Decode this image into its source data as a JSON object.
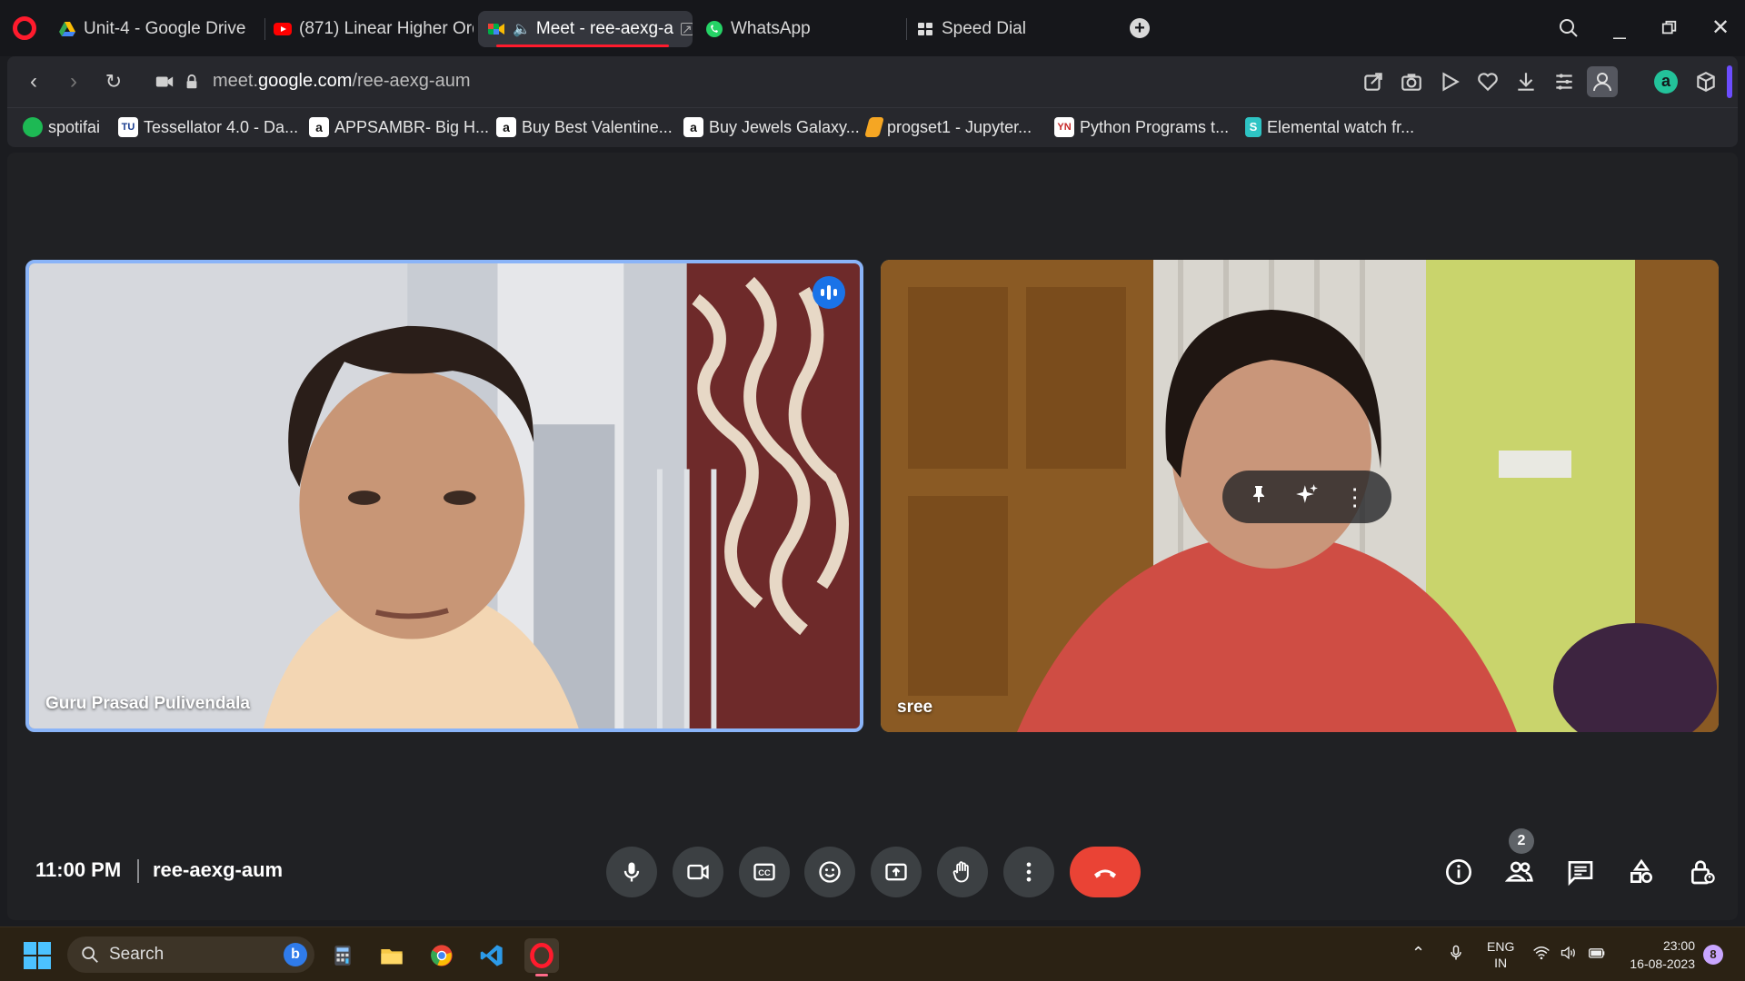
{
  "browser": {
    "tabs": [
      {
        "label": "Unit-4 - Google Drive",
        "icon": "google-drive-icon"
      },
      {
        "label": "(871) Linear Higher Ord",
        "icon": "youtube-icon"
      },
      {
        "label": "Meet - ree-aexg-a",
        "icon": "google-meet-icon",
        "active": true
      },
      {
        "label": "WhatsApp",
        "icon": "whatsapp-icon"
      },
      {
        "label": "Speed Dial",
        "icon": "speed-dial-icon"
      }
    ],
    "url_host": "meet.google.com",
    "url_host_bold": "google.com",
    "url_prefix": "meet.",
    "url_path": "/ree-aexg-aum",
    "bookmarks": [
      {
        "label": "spotifai",
        "icon": "spotify-icon"
      },
      {
        "label": "Tessellator 4.0 - Da...",
        "icon": "tessellator-icon"
      },
      {
        "label": "APPSAMBR- Big H...",
        "icon": "amazon-icon"
      },
      {
        "label": "Buy Best Valentine...",
        "icon": "amazon-icon"
      },
      {
        "label": "Buy Jewels Galaxy...",
        "icon": "amazon-icon"
      },
      {
        "label": "progset1 - Jupyter...",
        "icon": "jupyter-icon"
      },
      {
        "label": "Python Programs t...",
        "icon": "python-programs-icon"
      },
      {
        "label": "Elemental watch fr...",
        "icon": "skype-icon"
      }
    ]
  },
  "meet": {
    "participants": [
      {
        "name": "Guru Prasad Pulivendala",
        "speaking": true
      },
      {
        "name": "sree",
        "speaking": false
      }
    ],
    "time": "11:00 PM",
    "meeting_code": "ree-aexg-aum",
    "people_count": "2"
  },
  "taskbar": {
    "search_placeholder": "Search",
    "lang_top": "ENG",
    "lang_bottom": "IN",
    "time": "23:00",
    "date": "16-08-2023",
    "notification_count": "8"
  },
  "colors": {
    "accent_red": "#ff1b2d",
    "meet_end_call": "#ea4335",
    "active_speaker_border": "#8ab4f8",
    "meet_blue": "#1a73e8"
  }
}
